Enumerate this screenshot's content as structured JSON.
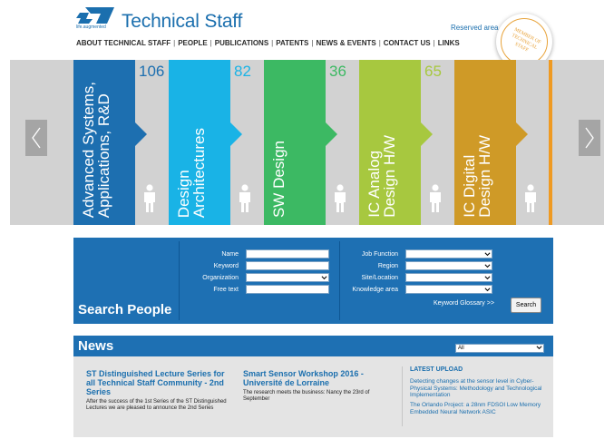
{
  "header": {
    "logo_tagline": "life.augmented",
    "site_title": "Technical Staff",
    "reserved_link": "Reserved area",
    "badge_text": "Member of Technical Staff",
    "nav": [
      "ABOUT TECHNICAL STAFF",
      "PEOPLE",
      "PUBLICATIONS",
      "PATENTS",
      "NEWS & EVENTS",
      "CONTACT US",
      "LINKS"
    ],
    "nav_separator": "|"
  },
  "carousel": {
    "panels": [
      {
        "label": "Advanced Systems,\nApplications, R&D",
        "count": "106",
        "color": "#1d6fb0",
        "count_color": "#1d6fb0"
      },
      {
        "label": "Design\nArchitectures",
        "count": "82",
        "color": "#19b3e6",
        "count_color": "#19b3e6"
      },
      {
        "label": "SW Design",
        "count": "36",
        "color": "#3cb963",
        "count_color": "#3cb963"
      },
      {
        "label": "IC Analog\nDesign H/W",
        "count": "65",
        "color": "#a7c83f",
        "count_color": "#a7c83f"
      },
      {
        "label": "IC Digital\nDesign H/W",
        "count": "",
        "color": "#cf9a27",
        "count_color": "#cf9a27"
      }
    ],
    "prev_icon": "chevron-left-icon",
    "next_icon": "chevron-right-icon"
  },
  "search": {
    "title": "Search People",
    "left_fields": [
      {
        "label": "Name",
        "type": "text",
        "value": ""
      },
      {
        "label": "Keyword",
        "type": "text",
        "value": ""
      },
      {
        "label": "Organization",
        "type": "select",
        "value": ""
      },
      {
        "label": "Free text",
        "type": "text",
        "value": ""
      }
    ],
    "right_fields": [
      {
        "label": "Job Function",
        "type": "select",
        "value": ""
      },
      {
        "label": "Region",
        "type": "select",
        "value": ""
      },
      {
        "label": "Site/Location",
        "type": "select",
        "value": ""
      },
      {
        "label": "Knowledge area",
        "type": "select",
        "value": ""
      }
    ],
    "glossary_link": "Keyword Glossary >>",
    "button": "Search"
  },
  "news": {
    "title": "News",
    "filter_value": "All",
    "articles": [
      {
        "title": "ST Distinguished Lecture Series for all Technical Staff Community - 2nd Series",
        "body": "After the success of the 1st Series of the ST Distinguished Lectures we are pleased to announce the 2nd Series"
      },
      {
        "title": "Smart Sensor Workshop 2016 - Université de Lorraine",
        "body": "The research meets the business: Nancy the 23rd of September"
      }
    ],
    "latest_heading": "LATEST UPLOAD",
    "latest_items": [
      "Detecting changes at the sensor level in Cyber-Physical Systems: Methodology and Technological Implementation",
      "The Orlando Project: a 28nm FDSOI Low Memory Embedded Neural Network ASIC"
    ]
  }
}
